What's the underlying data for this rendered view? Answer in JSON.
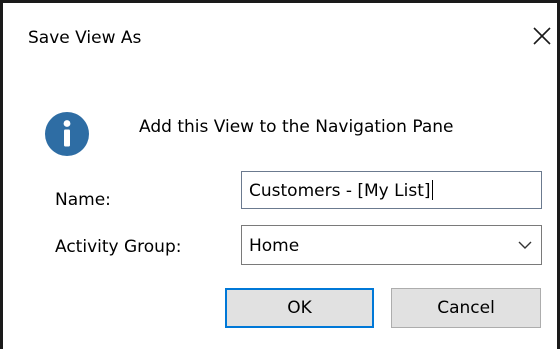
{
  "window": {
    "title": "Save View As",
    "close_icon": "close-icon"
  },
  "message": {
    "icon": "info-icon",
    "text": "Add this View to the Navigation Pane"
  },
  "form": {
    "name_label": "Name:",
    "name_value": "Customers - [My List]",
    "group_label": "Activity Group:",
    "group_value": "Home"
  },
  "buttons": {
    "ok_label": "OK",
    "cancel_label": "Cancel"
  },
  "colors": {
    "info_icon": "#2e6da4",
    "default_button_border": "#0078d7",
    "button_face": "#e1e1e1"
  }
}
